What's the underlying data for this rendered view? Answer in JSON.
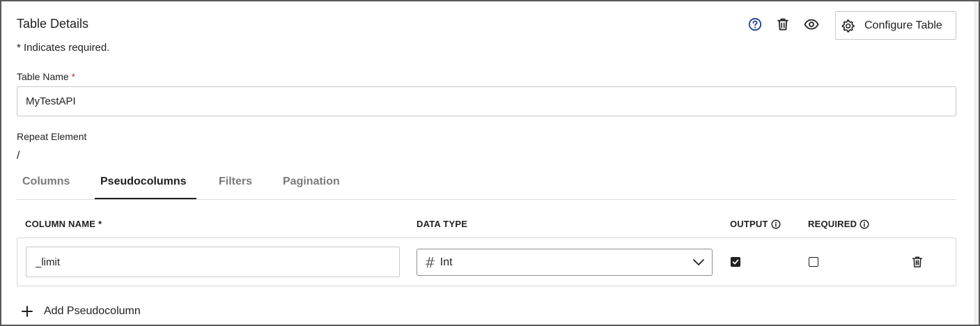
{
  "header": {
    "title": "Table Details",
    "required_note": "* Indicates required.",
    "configure_label": "Configure Table"
  },
  "table_name": {
    "label": "Table Name",
    "required_mark": "*",
    "value": "MyTestAPI"
  },
  "repeat_element": {
    "label": "Repeat Element",
    "value": "/"
  },
  "tabs": [
    {
      "label": "Columns",
      "active": false
    },
    {
      "label": "Pseudocolumns",
      "active": true
    },
    {
      "label": "Filters",
      "active": false
    },
    {
      "label": "Pagination",
      "active": false
    }
  ],
  "grid": {
    "headers": {
      "column_name": "COLUMN NAME *",
      "data_type": "DATA TYPE",
      "output": "OUTPUT",
      "required": "REQUIRED"
    },
    "rows": [
      {
        "column_name": "_limit",
        "data_type": "Int",
        "data_type_icon": "#",
        "output": true,
        "required": false
      }
    ]
  },
  "add_label": "Add Pseudocolumn",
  "colors": {
    "accent": "#1a3d8f",
    "required_star": "#d0312d",
    "text": "#1f1f1f"
  }
}
